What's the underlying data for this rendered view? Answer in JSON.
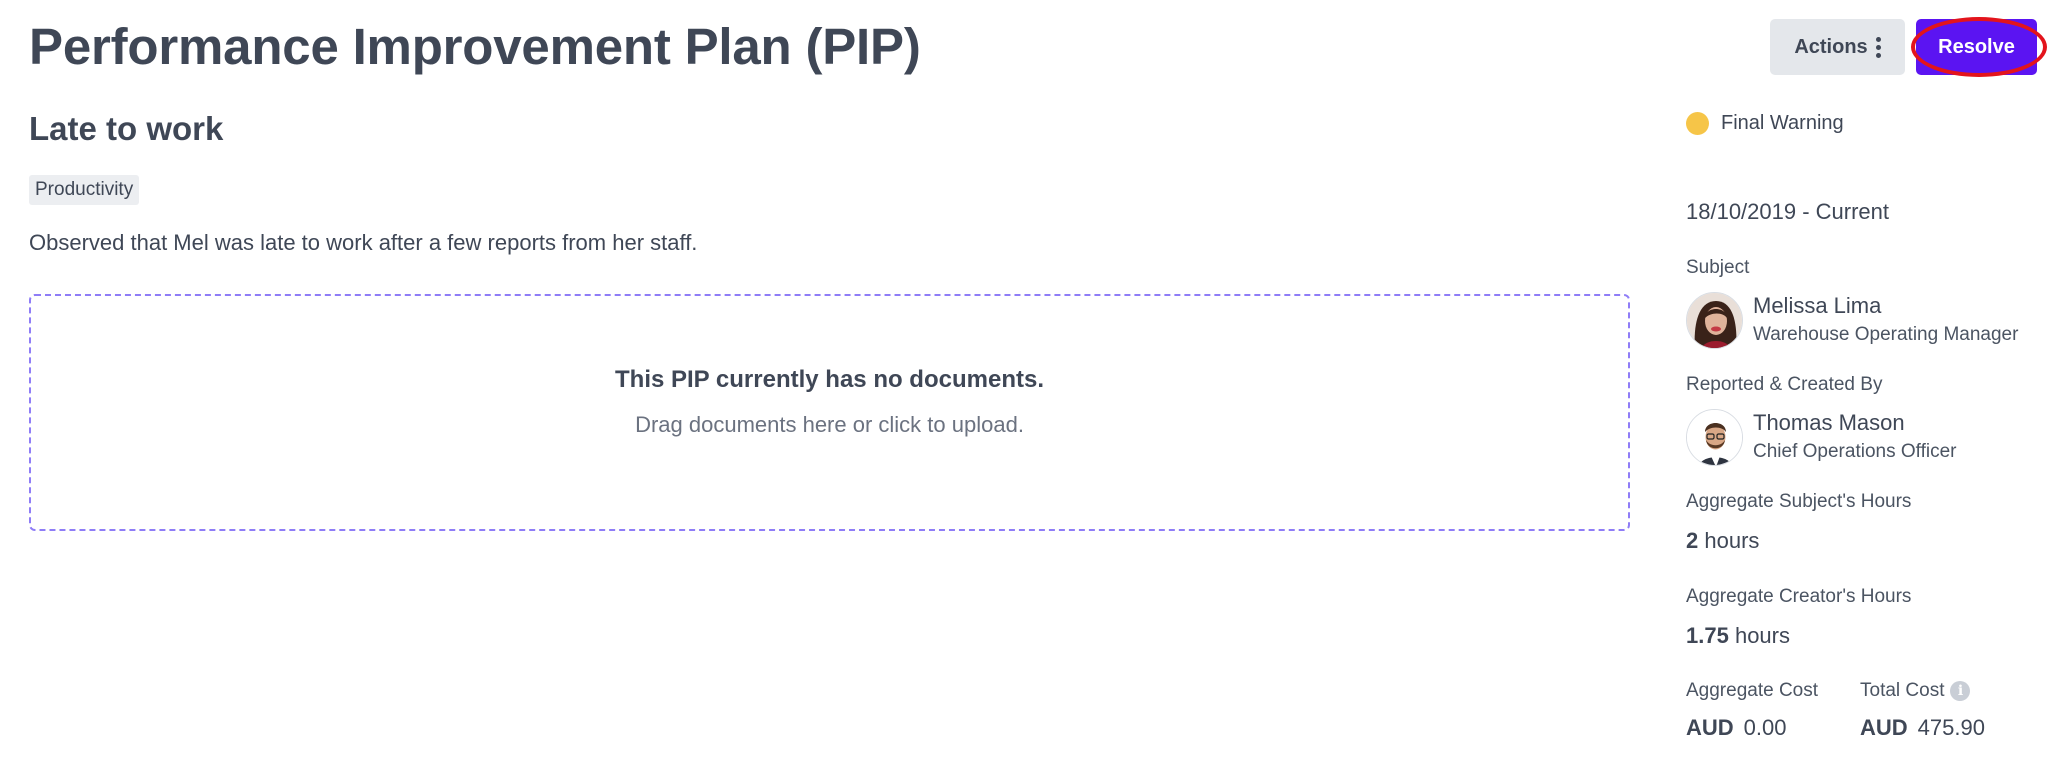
{
  "header": {
    "title": "Performance Improvement Plan (PIP)",
    "actions_label": "Actions",
    "resolve_label": "Resolve"
  },
  "main": {
    "subtitle": "Late to work",
    "tag": "Productivity",
    "description": "Observed that Mel was late to work after a few reports from her staff.",
    "dropzone": {
      "title": "This PIP currently has no documents.",
      "hint": "Drag documents here or click to upload."
    }
  },
  "sidebar": {
    "status": "Final Warning",
    "date_range": "18/10/2019 - Current",
    "subject": {
      "label": "Subject",
      "name": "Melissa Lima",
      "role": "Warehouse Operating Manager"
    },
    "reporter": {
      "label": "Reported & Created By",
      "name": "Thomas Mason",
      "role": "Chief Operations Officer"
    },
    "subject_hours": {
      "label": "Aggregate Subject's Hours",
      "value": "2",
      "unit": "hours"
    },
    "creator_hours": {
      "label": "Aggregate Creator's Hours",
      "value": "1.75",
      "unit": "hours"
    },
    "aggregate_cost": {
      "label": "Aggregate Cost",
      "currency": "AUD",
      "value": "0.00"
    },
    "total_cost": {
      "label": "Total Cost",
      "currency": "AUD",
      "value": "475.90"
    }
  },
  "colors": {
    "primary": "#5b14f2",
    "status_warning": "#f6c548",
    "highlight": "#e3141c",
    "dropzone_border": "#8f7df7"
  },
  "icons": [
    "kebab-menu-icon",
    "status-dot-icon",
    "info-icon"
  ]
}
